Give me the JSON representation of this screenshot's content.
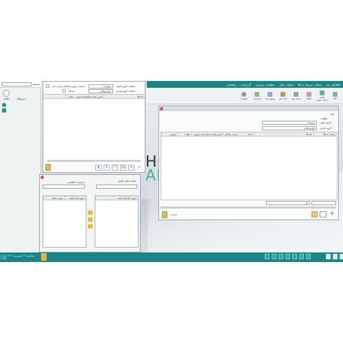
{
  "top_menu": [
    "اطلاعات پایه",
    "عملیات مرتبط به کالا",
    "عملیات مالی",
    "تنظیمات مدیریتی",
    "گزارشات",
    "راهنمائی"
  ],
  "ribbon_buttons": [
    "کالا",
    "طرف حساب بانکی",
    "کالاها",
    "تعدیل سند",
    "اخذ مالی",
    "وصول چک",
    "گزارشات",
    "تنظیمات"
  ],
  "brand": {
    "line1": "HO",
    "line2": "AR"
  },
  "left_panel": {
    "search_label": "جستجو",
    "items": [
      "تکلیف",
      "شروع‌کار"
    ]
  },
  "status": {
    "date": "سه‌شنبه ۱۲ فروردین ۱۴۰۱ ساعت ۱۹:۵۴"
  },
  "window_goods": {
    "title": "کالا",
    "tab": "کالا",
    "label_main": "طبقات",
    "group_main_label": "گروه اصلی :",
    "group_main_value": "موجودات",
    "group_sub_label": "گروه فرعی :",
    "group_sub_value": "جوامع وکالتی",
    "columns": [
      "ردیف",
      "کد کالا",
      "نام کالا",
      "تعداد",
      "قیمت میانگین",
      "آخرین قیمت خرید",
      "قیمت فروش",
      "مالیات",
      "عوارض"
    ],
    "search_placeholder": "نام"
  },
  "window_report": {
    "group_main_label": "انتخاب گروه اصلی :",
    "group_main_value": "موجودات",
    "group_sub_label": "انتخاب گروه فرعی :",
    "group_sub_value": "جوامع وکالتی",
    "checkbox1": "احتساب موجودی کالاهای خارج از انبار",
    "checkbox2": "نام کالا",
    "columns": [
      "نام کالا",
      "آخرین قیمت خرید",
      "قیمت فروش",
      "مقدار"
    ]
  },
  "window_columns": {
    "title": "انتخاب فایل اکسل",
    "list_label": "نام لیست اطلاعاتی",
    "left_header": "ستون های فایل اکسل",
    "right_header_a": "ستون فایل اکسل",
    "right_header_b": "ستون متناظر"
  }
}
